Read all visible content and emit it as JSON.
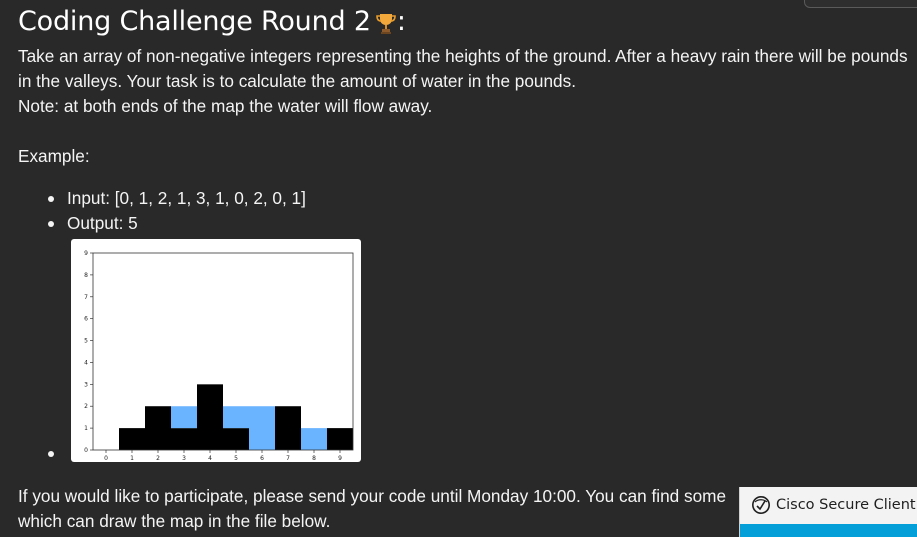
{
  "page": {
    "title": "Coding Challenge Round 2",
    "title_suffix": ":",
    "paragraphs": [
      "Take an array of non-negative integers representing the heights of the ground. After a heavy rain there will be pounds",
      "in the valleys. Your task is to calculate the amount of water in the pounds.",
      "Note: at both ends of the map the water will flow away."
    ],
    "example_heading": "Example:",
    "example_items": [
      "Input: [0, 1, 2, 1, 3, 1, 0, 2, 0, 1]",
      "Output: 5"
    ],
    "footer_lines": [
      "If you would like to participate, please send your code until Monday 10:00. You can find some",
      "which can draw the map in the file below."
    ]
  },
  "icons": {
    "trophy": "trophy-icon",
    "client_logo": "cisco-logo-icon",
    "list_bullet": "bullet-dot"
  },
  "notification": {
    "label": "Cisco Secure Client",
    "accent_color": "#049fd9"
  },
  "colors": {
    "background": "#292929",
    "text": "#ffffff",
    "ground": "#000000",
    "water": "#6ab4ff"
  },
  "chart_data": {
    "type": "bar",
    "categories": [
      "0",
      "1",
      "2",
      "3",
      "4",
      "5",
      "6",
      "7",
      "8",
      "9"
    ],
    "x": [
      0,
      1,
      2,
      3,
      4,
      5,
      6,
      7,
      8,
      9
    ],
    "series": [
      {
        "values": [
          0,
          1,
          2,
          1,
          3,
          1,
          0,
          2,
          0,
          1
        ],
        "color": "#000000"
      },
      {
        "values": [
          0,
          0,
          0,
          1,
          0,
          1,
          2,
          0,
          1,
          0
        ],
        "color": "#6ab4ff",
        "stacked_on_previous": true
      }
    ],
    "xlim": [
      -0.5,
      9.5
    ],
    "ylim": [
      0,
      9
    ],
    "xticks": [
      "0",
      "1",
      "2",
      "3",
      "4",
      "5",
      "6",
      "7",
      "8",
      "9"
    ],
    "yticks": [
      "0",
      "1",
      "2",
      "3",
      "4",
      "5",
      "6",
      "7",
      "8",
      "9"
    ],
    "title": "",
    "xlabel": "",
    "ylabel": "",
    "grid": false
  }
}
